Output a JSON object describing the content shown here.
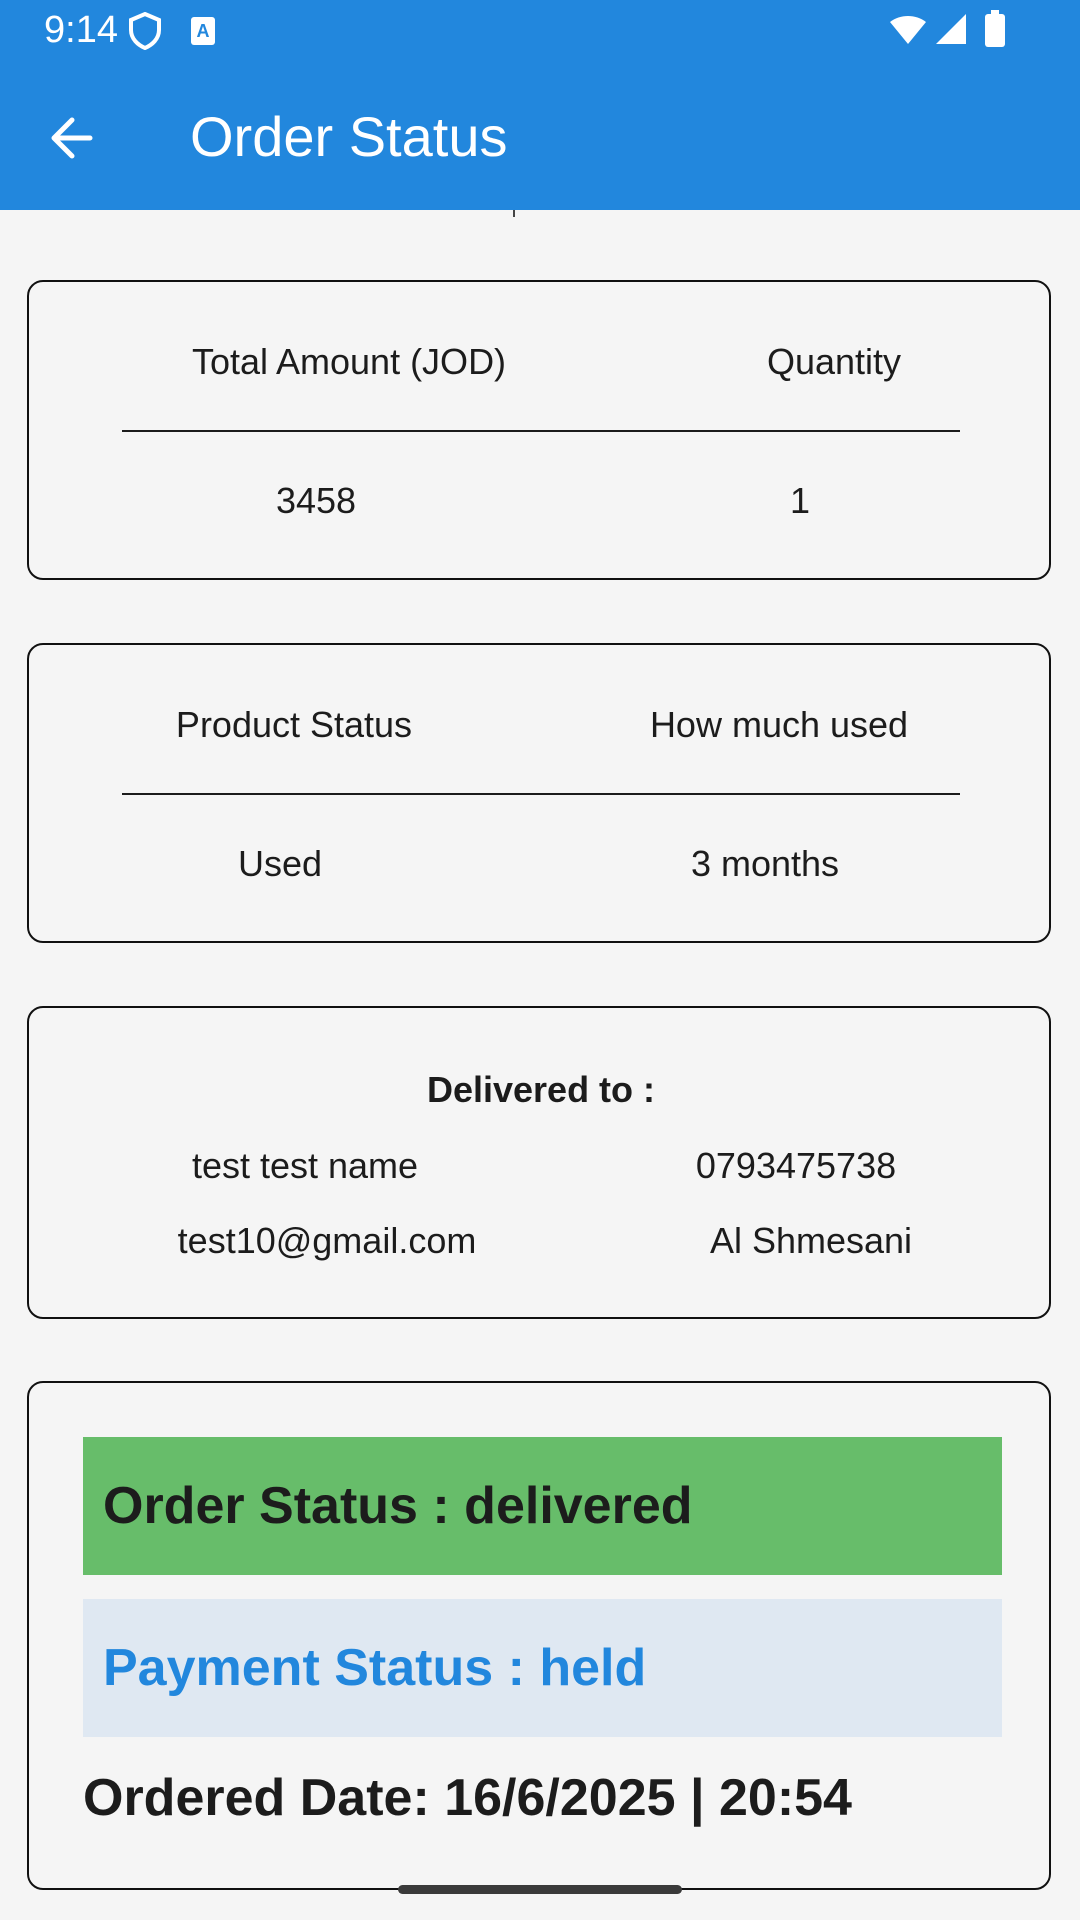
{
  "status_bar": {
    "time": "9:14",
    "left_icons": [
      "shield-icon",
      "text-a-icon"
    ],
    "right_icons": [
      "wifi-icon",
      "signal-icon",
      "battery-icon"
    ]
  },
  "app_bar": {
    "back_icon": "arrow-back-icon",
    "title": "Order Status"
  },
  "amount_card": {
    "headers": [
      "Total Amount (JOD)",
      "Quantity"
    ],
    "values": [
      "3458",
      "1"
    ]
  },
  "product_card": {
    "headers": [
      "Product Status",
      "How much used"
    ],
    "values": [
      "Used",
      "3 months"
    ]
  },
  "delivery_card": {
    "heading": "Delivered to :",
    "name": "test test name",
    "phone": "0793475738",
    "email": "test10@gmail.com",
    "area": "Al Shmesani"
  },
  "status_card": {
    "order_status": "Order Status : delivered",
    "payment_status": "Payment Status : held",
    "ordered_date": "Ordered Date: 16/6/2025 | 20:54"
  },
  "colors": {
    "primary": "#2287dd",
    "delivered_bg": "#67bd6a",
    "payment_bg": "#dfe8f2",
    "background": "#f5f5f5"
  }
}
